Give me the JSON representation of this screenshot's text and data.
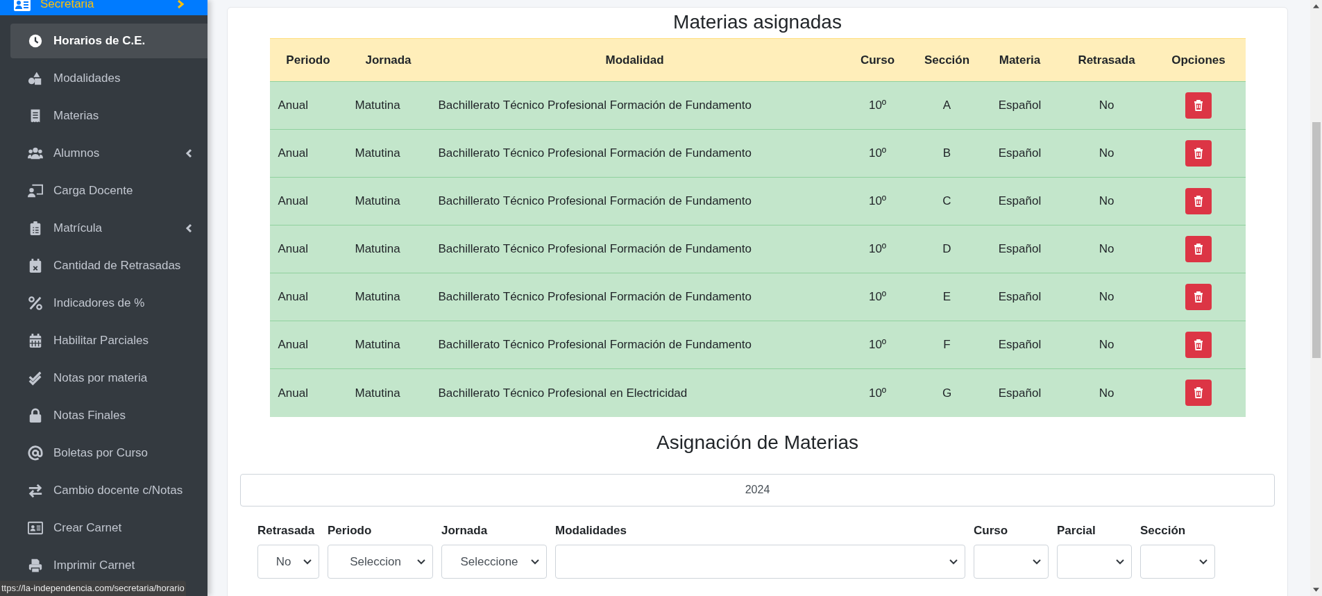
{
  "sidebar": {
    "section": {
      "label": "Secretaria",
      "expanded": true
    },
    "items": [
      {
        "label": "Horarios de C.E.",
        "selected": true,
        "submenu": false
      },
      {
        "label": "Modalidades",
        "selected": false,
        "submenu": false
      },
      {
        "label": "Materias",
        "selected": false,
        "submenu": false
      },
      {
        "label": "Alumnos",
        "selected": false,
        "submenu": true
      },
      {
        "label": "Carga Docente",
        "selected": false,
        "submenu": false
      },
      {
        "label": "Matrícula",
        "selected": false,
        "submenu": true
      },
      {
        "label": "Cantidad de Retrasadas",
        "selected": false,
        "submenu": false
      },
      {
        "label": "Indicadores de %",
        "selected": false,
        "submenu": false
      },
      {
        "label": "Habilitar Parciales",
        "selected": false,
        "submenu": false
      },
      {
        "label": "Notas por materia",
        "selected": false,
        "submenu": false
      },
      {
        "label": "Notas Finales",
        "selected": false,
        "submenu": false
      },
      {
        "label": "Boletas por Curso",
        "selected": false,
        "submenu": false
      },
      {
        "label": "Cambio docente c/Notas",
        "selected": false,
        "submenu": false
      },
      {
        "label": "Crear Carnet",
        "selected": false,
        "submenu": false
      },
      {
        "label": "Imprimir Carnet",
        "selected": false,
        "submenu": false
      }
    ]
  },
  "assigned": {
    "title": "Materias asignadas",
    "columns": [
      "Periodo",
      "Jornada",
      "Modalidad",
      "Curso",
      "Sección",
      "Materia",
      "Retrasada",
      "Opciones"
    ],
    "rows": [
      {
        "cells": [
          "Anual",
          "Matutina",
          "Bachillerato Técnico Profesional Formación de Fundamento",
          "10º",
          "A",
          "Español",
          "No"
        ]
      },
      {
        "cells": [
          "Anual",
          "Matutina",
          "Bachillerato Técnico Profesional Formación de Fundamento",
          "10º",
          "B",
          "Español",
          "No"
        ]
      },
      {
        "cells": [
          "Anual",
          "Matutina",
          "Bachillerato Técnico Profesional Formación de Fundamento",
          "10º",
          "C",
          "Español",
          "No"
        ]
      },
      {
        "cells": [
          "Anual",
          "Matutina",
          "Bachillerato Técnico Profesional Formación de Fundamento",
          "10º",
          "D",
          "Español",
          "No"
        ]
      },
      {
        "cells": [
          "Anual",
          "Matutina",
          "Bachillerato Técnico Profesional Formación de Fundamento",
          "10º",
          "E",
          "Español",
          "No"
        ]
      },
      {
        "cells": [
          "Anual",
          "Matutina",
          "Bachillerato Técnico Profesional Formación de Fundamento",
          "10º",
          "F",
          "Español",
          "No"
        ]
      },
      {
        "cells": [
          "Anual",
          "Matutina",
          "Bachillerato Técnico Profesional en Electricidad",
          "10º",
          "G",
          "Español",
          "No"
        ]
      }
    ]
  },
  "assignment": {
    "title": "Asignación de Materias",
    "year": "2024",
    "fields": [
      {
        "label": "Retrasada",
        "value": "No"
      },
      {
        "label": "Periodo",
        "value": "Seleccion"
      },
      {
        "label": "Jornada",
        "value": "Seleccione"
      },
      {
        "label": "Modalidades"
      },
      {
        "label": "Curso"
      },
      {
        "label": "Parcial"
      },
      {
        "label": "Sección"
      }
    ]
  },
  "status_bar": {
    "url": "ttps://la-independencia.com/secretaria/horario"
  }
}
